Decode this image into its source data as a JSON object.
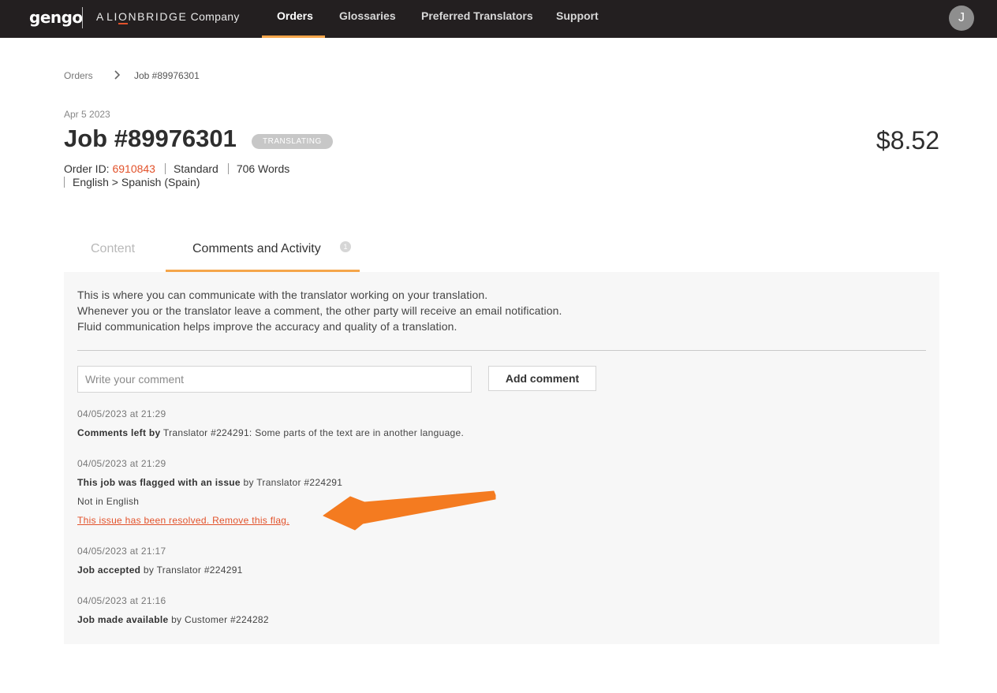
{
  "nav": {
    "logo": "gengo",
    "company_prefix": "A",
    "company_brand_pre": "LI",
    "company_brand_accent": "O",
    "company_brand_post": "NBRIDGE",
    "company_suffix": "Company",
    "items": [
      {
        "label": "Orders",
        "active": true
      },
      {
        "label": "Glossaries",
        "active": false
      },
      {
        "label": "Preferred Translators",
        "active": false
      },
      {
        "label": "Support",
        "active": false
      }
    ],
    "avatar_initial": "J",
    "accent_color": "#f5a54a"
  },
  "breadcrumb": {
    "root": "Orders",
    "current": "Job #89976301"
  },
  "job": {
    "date": "Apr 5 2023",
    "title": "Job #89976301",
    "status": "TRANSLATING",
    "price": "$8.52",
    "order_label": "Order ID:",
    "order_id": "6910843",
    "tier": "Standard",
    "words": "706 Words",
    "language_pair": "English > Spanish (Spain)"
  },
  "tabs": {
    "content": "Content",
    "comments": "Comments and Activity",
    "comments_badge": "1"
  },
  "panel": {
    "intro": [
      "This is where you can communicate with the translator working on your translation.",
      "Whenever you or the translator leave a comment, the other party will receive an email notification.",
      "Fluid communication helps improve the accuracy and quality of a translation."
    ],
    "comment_placeholder": "Write your comment",
    "add_comment_label": "Add comment"
  },
  "activity": [
    {
      "timestamp": "04/05/2023 at 21:29",
      "bold": "Comments left by",
      "text": " Translator #224291: Some parts of the text are in another language."
    },
    {
      "timestamp": "04/05/2023 at 21:29",
      "bold": "This job was flagged with an issue",
      "text": " by Translator #224291",
      "detail": "Not in English",
      "link": "This issue has been resolved. Remove this flag."
    },
    {
      "timestamp": "04/05/2023 at 21:17",
      "bold": "Job accepted",
      "text": " by Translator #224291"
    },
    {
      "timestamp": "04/05/2023 at 21:16",
      "bold": "Job made available",
      "text": " by Customer #224282"
    }
  ],
  "colors": {
    "brand_red": "#e2522b",
    "nav_bg": "#231f20",
    "annotation_arrow": "#f47b20"
  }
}
